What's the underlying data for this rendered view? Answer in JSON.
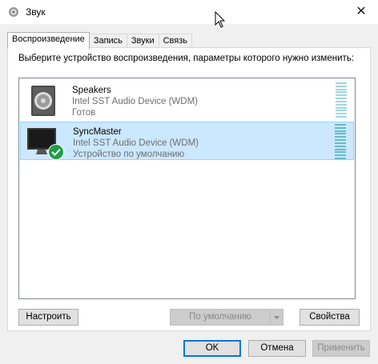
{
  "window": {
    "title": "Звук",
    "close_glyph": "✕"
  },
  "tabs": [
    {
      "label": "Воспроизведение",
      "active": true
    },
    {
      "label": "Запись",
      "active": false
    },
    {
      "label": "Звуки",
      "active": false
    },
    {
      "label": "Связь",
      "active": false
    }
  ],
  "instruction": "Выберите устройство воспроизведения, параметры которого нужно изменить:",
  "devices": [
    {
      "name": "Speakers",
      "driver": "Intel SST Audio Device (WDM)",
      "status": "Готов",
      "selected": false,
      "icon": "speaker-icon"
    },
    {
      "name": "SyncMaster",
      "driver": "Intel SST Audio Device (WDM)",
      "status": "Устройство по умолчанию",
      "selected": true,
      "icon": "monitor-icon",
      "default_badge": "check-icon"
    }
  ],
  "buttons": {
    "configure": "Настроить",
    "set_default": "По умолчанию",
    "properties": "Свойства",
    "ok": "OK",
    "cancel": "Отмена",
    "apply": "Применить"
  },
  "colors": {
    "selection": "#cce8ff",
    "default_check": "#1e9e48",
    "meter": "#62bcd0"
  }
}
